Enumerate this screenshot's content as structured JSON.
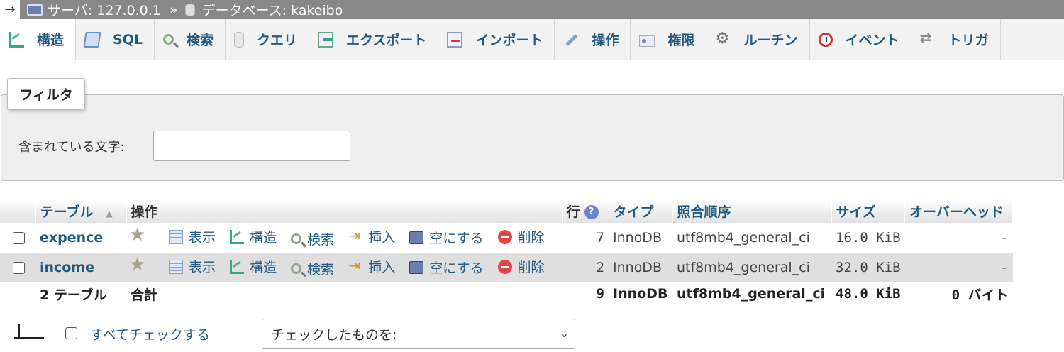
{
  "breadcrumb": {
    "arrow": "→",
    "server": "サーバ: 127.0.0.1",
    "separator": "»",
    "database": "データベース: kakeibo"
  },
  "tabs": [
    {
      "label": "構造",
      "icon": "structure-icon",
      "active": true
    },
    {
      "label": "SQL",
      "icon": "sql-icon"
    },
    {
      "label": "検索",
      "icon": "search-icon"
    },
    {
      "label": "クエリ",
      "icon": "query-icon"
    },
    {
      "label": "エクスポート",
      "icon": "export-icon"
    },
    {
      "label": "インポート",
      "icon": "import-icon"
    },
    {
      "label": "操作",
      "icon": "wrench-icon"
    },
    {
      "label": "権限",
      "icon": "privileges-icon"
    },
    {
      "label": "ルーチン",
      "icon": "routine-icon"
    },
    {
      "label": "イベント",
      "icon": "event-icon"
    },
    {
      "label": "トリガ",
      "icon": "trigger-icon"
    }
  ],
  "filter": {
    "legend": "フィルタ",
    "label": "含まれている文字:",
    "value": ""
  },
  "table": {
    "headers": {
      "table": "テーブル",
      "action": "操作",
      "rows": "行",
      "type": "タイプ",
      "collation": "照合順序",
      "size": "サイズ",
      "overhead": "オーバーヘッド"
    },
    "sort_glyph": "▲",
    "help_glyph": "?",
    "action_labels": {
      "browse": "表示",
      "structure": "構造",
      "search": "検索",
      "insert": "挿入",
      "empty": "空にする",
      "drop": "削除"
    },
    "rows": [
      {
        "name": "expence",
        "rows": "7",
        "type": "InnoDB",
        "collation": "utf8mb4_general_ci",
        "size": "16.0 KiB",
        "overhead": "-"
      },
      {
        "name": "income",
        "rows": "2",
        "type": "InnoDB",
        "collation": "utf8mb4_general_ci",
        "size": "32.0 KiB",
        "overhead": "-"
      }
    ],
    "summary": {
      "count": "2 テーブル",
      "label": "合計",
      "rows": "9",
      "type": "InnoDB",
      "collation": "utf8mb4_general_ci",
      "size": "48.0 KiB",
      "overhead": "0 バイト"
    }
  },
  "bottom": {
    "check_all": "すべてチェックする",
    "bulk_select": "チェックしたものを:",
    "chevron": "⌄"
  }
}
